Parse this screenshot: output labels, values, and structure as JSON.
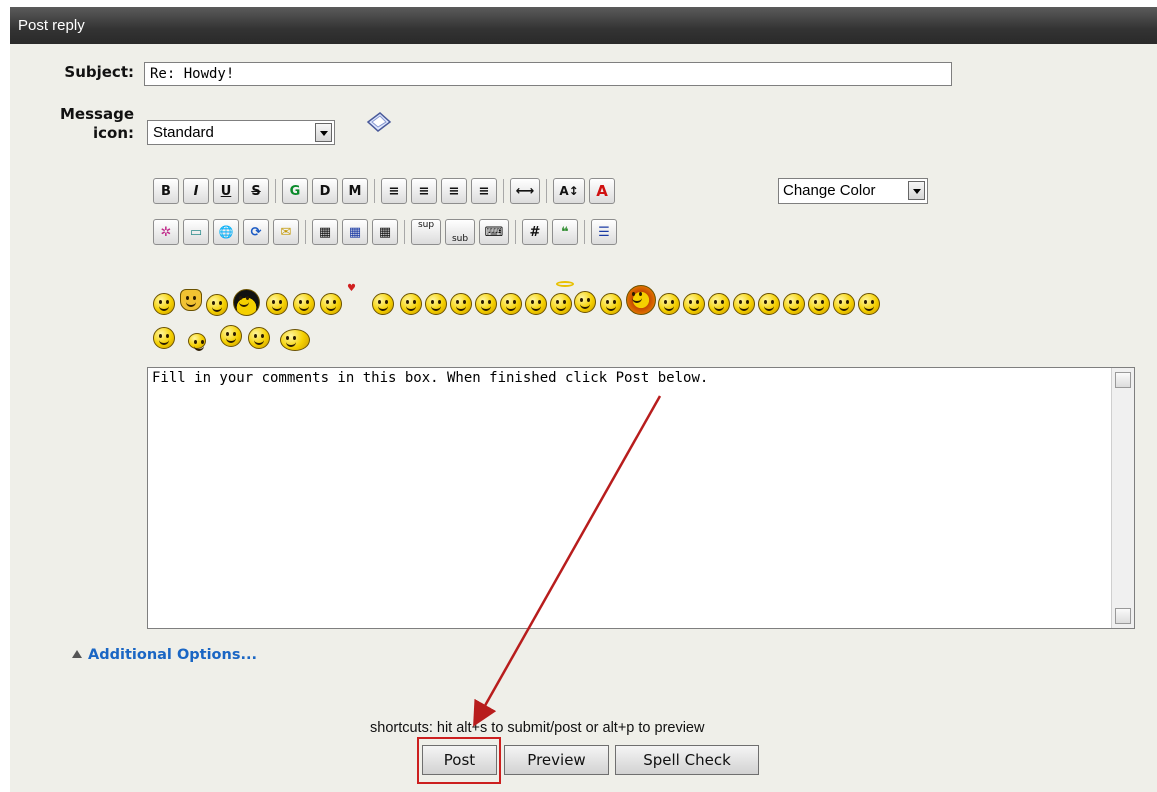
{
  "header": {
    "title": "Post reply"
  },
  "form": {
    "subject_label": "Subject:",
    "subject_value": "Re: Howdy!",
    "message_icon_label_1": "Message",
    "message_icon_label_2": "icon:",
    "message_icon_selected": "Standard"
  },
  "toolbar": {
    "row1": [
      {
        "name": "bold-button",
        "glyph": "B"
      },
      {
        "name": "italic-button",
        "glyph": "I"
      },
      {
        "name": "underline-button",
        "glyph": "U"
      },
      {
        "name": "strikethrough-button",
        "glyph": "S"
      },
      {
        "name": "glow-button",
        "glyph": "G"
      },
      {
        "name": "shadow-button",
        "glyph": "D"
      },
      {
        "name": "marquee-button",
        "glyph": "M"
      },
      {
        "name": "pre-button",
        "glyph": "≡"
      },
      {
        "name": "align-left-button",
        "glyph": "≡"
      },
      {
        "name": "align-center-button",
        "glyph": "≡"
      },
      {
        "name": "align-right-button",
        "glyph": "≡"
      },
      {
        "name": "horizontal-rule-button",
        "glyph": "⟷"
      },
      {
        "name": "font-size-button",
        "glyph": "A↕"
      },
      {
        "name": "font-color-button",
        "glyph": "A"
      }
    ],
    "row2": [
      {
        "name": "flash-button",
        "glyph": "✲"
      },
      {
        "name": "image-button",
        "glyph": "▭"
      },
      {
        "name": "hyperlink-button",
        "glyph": "🌐"
      },
      {
        "name": "ftp-link-button",
        "glyph": "⟳"
      },
      {
        "name": "email-button",
        "glyph": "✉"
      },
      {
        "name": "table-button",
        "glyph": "▦"
      },
      {
        "name": "table-row-button",
        "glyph": "▦"
      },
      {
        "name": "table-column-button",
        "glyph": "▦"
      },
      {
        "name": "superscript-button",
        "glyph": "sup"
      },
      {
        "name": "subscript-button",
        "glyph": "sub"
      },
      {
        "name": "teletype-button",
        "glyph": "⌨"
      },
      {
        "name": "code-button",
        "glyph": "#"
      },
      {
        "name": "quote-button",
        "glyph": "❝"
      },
      {
        "name": "list-button",
        "glyph": "☰"
      }
    ],
    "color_select": "Change Color"
  },
  "message": {
    "text": "Fill in your comments in this box.  When finished click Post below."
  },
  "additional_options": "Additional Options...",
  "shortcuts": "shortcuts: hit alt+s to submit/post or alt+p to preview",
  "buttons": {
    "post": "Post",
    "preview": "Preview",
    "spell_check": "Spell Check"
  },
  "colors": {
    "header_bg": "#333333",
    "form_bg": "#efefe9",
    "link": "#1a66c4",
    "highlight": "#cc1f1f"
  }
}
